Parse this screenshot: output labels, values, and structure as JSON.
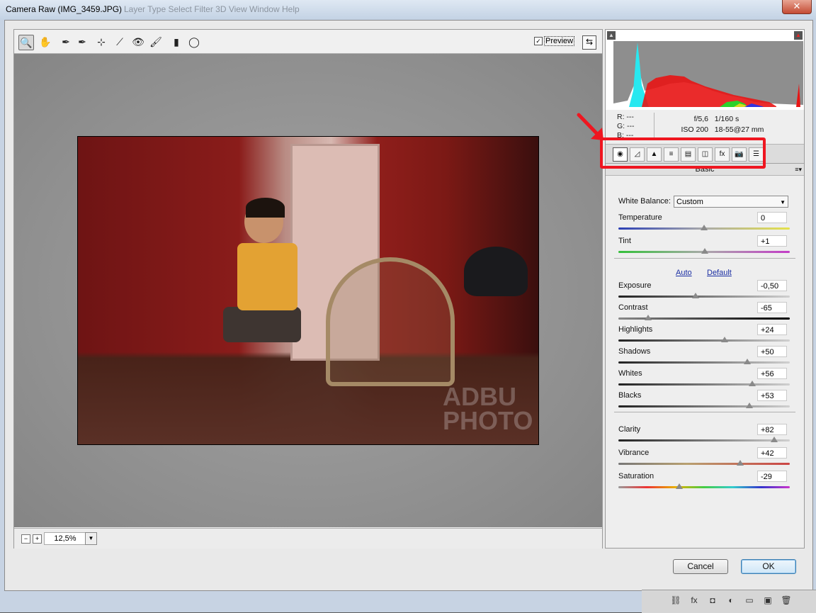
{
  "window": {
    "title": "Camera Raw (IMG_3459.JPG)",
    "ghost_menu": "Layer   Type   Select   Filter   3D   View   Window   Help",
    "close_glyph": "✕"
  },
  "toolbar": {
    "tools": [
      {
        "name": "zoom-tool",
        "glyph": "🔍"
      },
      {
        "name": "hand-tool",
        "glyph": "✋"
      },
      {
        "name": "white-balance-tool",
        "glyph": "✒"
      },
      {
        "name": "color-sampler-tool",
        "glyph": "✒"
      },
      {
        "name": "targeted-adjustment-tool",
        "glyph": "⊹"
      },
      {
        "name": "crop-tool",
        "glyph": "⟋"
      },
      {
        "name": "red-eye-tool",
        "glyph": "👁"
      },
      {
        "name": "adjustment-brush-tool",
        "glyph": "🖌"
      },
      {
        "name": "graduated-filter-tool",
        "glyph": "▮"
      },
      {
        "name": "radial-filter-tool",
        "glyph": "◯"
      }
    ],
    "preview_label": "Preview",
    "preview_checked": "✓",
    "fullscreen_glyph": "⇆"
  },
  "photo": {
    "watermark_line1": "ADBU",
    "watermark_line2": "PHOTO"
  },
  "zoom": {
    "minus": "−",
    "plus": "+",
    "value": "12,5%",
    "dropdown": "▼"
  },
  "histogram": {
    "clip_shadow_glyph": "▲",
    "clip_highlight_glyph": "▲"
  },
  "readout": {
    "r": "R:   ---",
    "g": "G:   ---",
    "b": "B:   ---",
    "aperture": "f/5,6",
    "shutter": "1/160 s",
    "iso": "ISO 200",
    "lens": "18-55@27 mm"
  },
  "tabs": [
    {
      "name": "tab-basic",
      "glyph": "◉"
    },
    {
      "name": "tab-tone-curve",
      "glyph": "◿"
    },
    {
      "name": "tab-detail",
      "glyph": "▲"
    },
    {
      "name": "tab-hsl",
      "glyph": "≡"
    },
    {
      "name": "tab-split-toning",
      "glyph": "▤"
    },
    {
      "name": "tab-lens-corrections",
      "glyph": "◫"
    },
    {
      "name": "tab-effects",
      "glyph": "fx"
    },
    {
      "name": "tab-camera-calibration",
      "glyph": "📷"
    },
    {
      "name": "tab-presets",
      "glyph": "☰"
    }
  ],
  "panel": {
    "title": "Basic",
    "menu_glyph": "≡▾",
    "white_balance_label": "White Balance:",
    "white_balance_value": "Custom",
    "dd_arrow": "▼",
    "auto_label": "Auto",
    "default_label": "Default",
    "sliders": [
      {
        "label": "Temperature",
        "value": "0",
        "pos": 0.5,
        "track": "temp"
      },
      {
        "label": "Tint",
        "value": "+1",
        "pos": 0.505,
        "track": "tint"
      },
      {
        "label": "Exposure",
        "value": "-0,50",
        "pos": 0.45,
        "track": "grey"
      },
      {
        "label": "Contrast",
        "value": "-65",
        "pos": 0.175,
        "track": "cont"
      },
      {
        "label": "Highlights",
        "value": "+24",
        "pos": 0.62,
        "track": "grey"
      },
      {
        "label": "Shadows",
        "value": "+50",
        "pos": 0.75,
        "track": "grey"
      },
      {
        "label": "Whites",
        "value": "+56",
        "pos": 0.78,
        "track": "grey"
      },
      {
        "label": "Blacks",
        "value": "+53",
        "pos": 0.765,
        "track": "grey"
      },
      {
        "label": "Clarity",
        "value": "+82",
        "pos": 0.91,
        "track": "grey"
      },
      {
        "label": "Vibrance",
        "value": "+42",
        "pos": 0.71,
        "track": "vib"
      },
      {
        "label": "Saturation",
        "value": "-29",
        "pos": 0.355,
        "track": "sat"
      }
    ]
  },
  "buttons": {
    "cancel": "Cancel",
    "ok": "OK"
  },
  "taskbar": {
    "icons": [
      {
        "name": "link-icon",
        "glyph": "⛓"
      },
      {
        "name": "fx-icon",
        "glyph": "fx"
      },
      {
        "name": "mask-icon",
        "glyph": "◘"
      },
      {
        "name": "adjustment-icon",
        "glyph": "◐"
      },
      {
        "name": "folder-icon",
        "glyph": "▭"
      },
      {
        "name": "new-layer-icon",
        "glyph": "▣"
      },
      {
        "name": "trash-icon",
        "glyph": "🗑"
      }
    ]
  }
}
